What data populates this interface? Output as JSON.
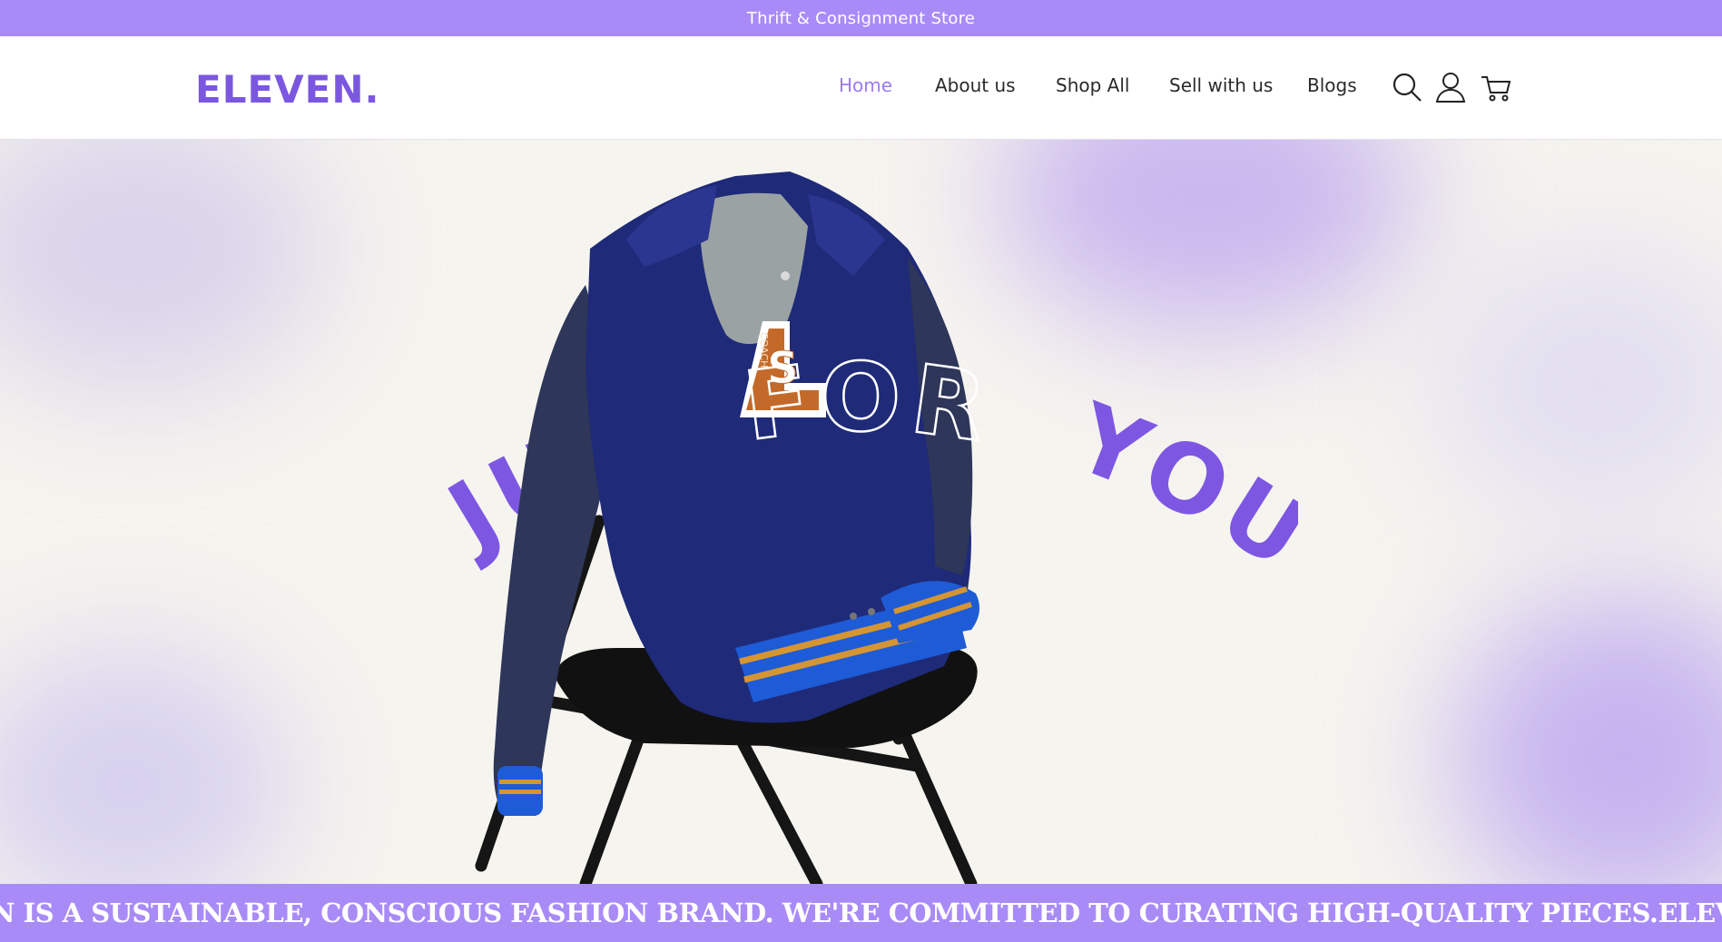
{
  "announcement": "Thrift & Consignment Store",
  "brand": {
    "logo": "ELEVEN."
  },
  "nav": {
    "items": [
      {
        "label": "Home",
        "active": true
      },
      {
        "label": "About us",
        "active": false
      },
      {
        "label": "Shop All",
        "active": false
      },
      {
        "label": "Sell with us",
        "active": false
      },
      {
        "label": "Blogs",
        "active": false
      }
    ]
  },
  "icons": {
    "search": "search-icon",
    "account": "user-icon",
    "cart": "cart-icon"
  },
  "hero": {
    "headline_word_1": "JUST",
    "headline_word_2": "FOR",
    "headline_word_3": "YOU",
    "patch_letters": "S",
    "patch_text": "COACH"
  },
  "marquee": {
    "text": "N IS A SUSTAINABLE, CONSCIOUS FASHION BRAND. WE'RE COMMITTED TO CURATING HIGH-QUALITY PIECES.ELEVEN IS A SUSTA"
  },
  "colors": {
    "accent": "#a98bf7",
    "brand": "#7b57e0",
    "nav_active": "#9b7bf0",
    "jacket": "#1f2a78",
    "sleeve": "#2a3358"
  }
}
